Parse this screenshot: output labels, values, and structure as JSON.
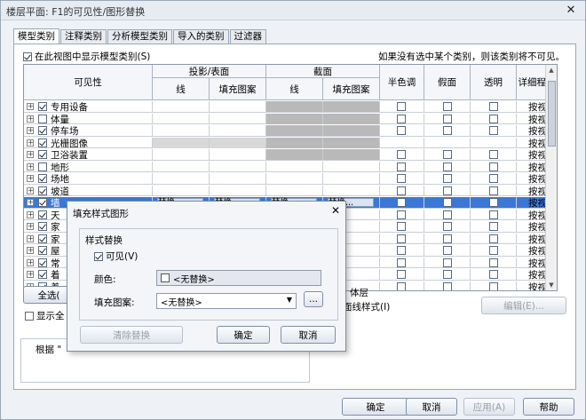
{
  "window": {
    "title": "楼层平面: F1的可见性/图形替换",
    "close": "✕"
  },
  "tabs": [
    "模型类别",
    "注释类别",
    "分析模型类别",
    "导入的类别",
    "过滤器"
  ],
  "show_model_categories": "在此视图中显示模型类别(S)",
  "hint": "如果没有选中某个类别，则该类别将不可见。",
  "headers": {
    "visibility": "可见性",
    "projection": "投影/表面",
    "cut": "截面",
    "line": "线",
    "fill": "填充图案",
    "halftone": "半色调",
    "ghost": "假面",
    "transparent": "透明",
    "detail": "详细程度"
  },
  "rows": [
    {
      "label": "专用设备",
      "checked": true,
      "detail": "按视图",
      "shade": "cut"
    },
    {
      "label": "体量",
      "checked": false,
      "detail": "按视图",
      "shade": "cut"
    },
    {
      "label": "停车场",
      "checked": true,
      "detail": "按视图",
      "shade": "cut"
    },
    {
      "label": "光栅图像",
      "checked": true,
      "detail": "按视图",
      "shade": "all"
    },
    {
      "label": "卫浴装置",
      "checked": true,
      "detail": "按视图",
      "shade": "cut"
    },
    {
      "label": "地形",
      "checked": false,
      "detail": "按视图",
      "shade": "none"
    },
    {
      "label": "场地",
      "checked": true,
      "detail": "按视图",
      "shade": "none"
    },
    {
      "label": "坡道",
      "checked": true,
      "detail": "按视图",
      "shade": "none"
    },
    {
      "label": "墙",
      "checked": true,
      "detail": "按视图",
      "shade": "none",
      "selected": true
    },
    {
      "label": "天",
      "checked": true,
      "detail": "按视图",
      "shade": "none"
    },
    {
      "label": "家",
      "checked": true,
      "detail": "按视图",
      "shade": "none"
    },
    {
      "label": "家",
      "checked": true,
      "detail": "按视图",
      "shade": "none"
    },
    {
      "label": "屋",
      "checked": true,
      "detail": "按视图",
      "shade": "none"
    },
    {
      "label": "常",
      "checked": true,
      "detail": "按视图",
      "shade": "none"
    },
    {
      "label": "着",
      "checked": true,
      "detail": "按视图",
      "shade": "none"
    },
    {
      "label": "着",
      "checked": true,
      "detail": "按视图",
      "shade": "none"
    }
  ],
  "override_label": "替换...",
  "buttons": {
    "select_all": "全选(",
    "edit": "编辑(E)...",
    "ok": "确定",
    "cancel": "取消",
    "apply": "应用(A)",
    "help": "帮助"
  },
  "show_all_label": "显示全",
  "based_on": "根据 \"",
  "layer_text": "体层",
  "layer_style": "面线样式(I)",
  "popup": {
    "title": "填充样式图形",
    "close": "✕",
    "group": "样式替换",
    "visible": "可见(V)",
    "color_label": "颜色:",
    "color_value": "<无替换>",
    "pattern_label": "填充图案:",
    "pattern_value": "<无替换>",
    "ellipsis": "...",
    "clear": "清除替换",
    "ok": "确定",
    "cancel": "取消"
  }
}
